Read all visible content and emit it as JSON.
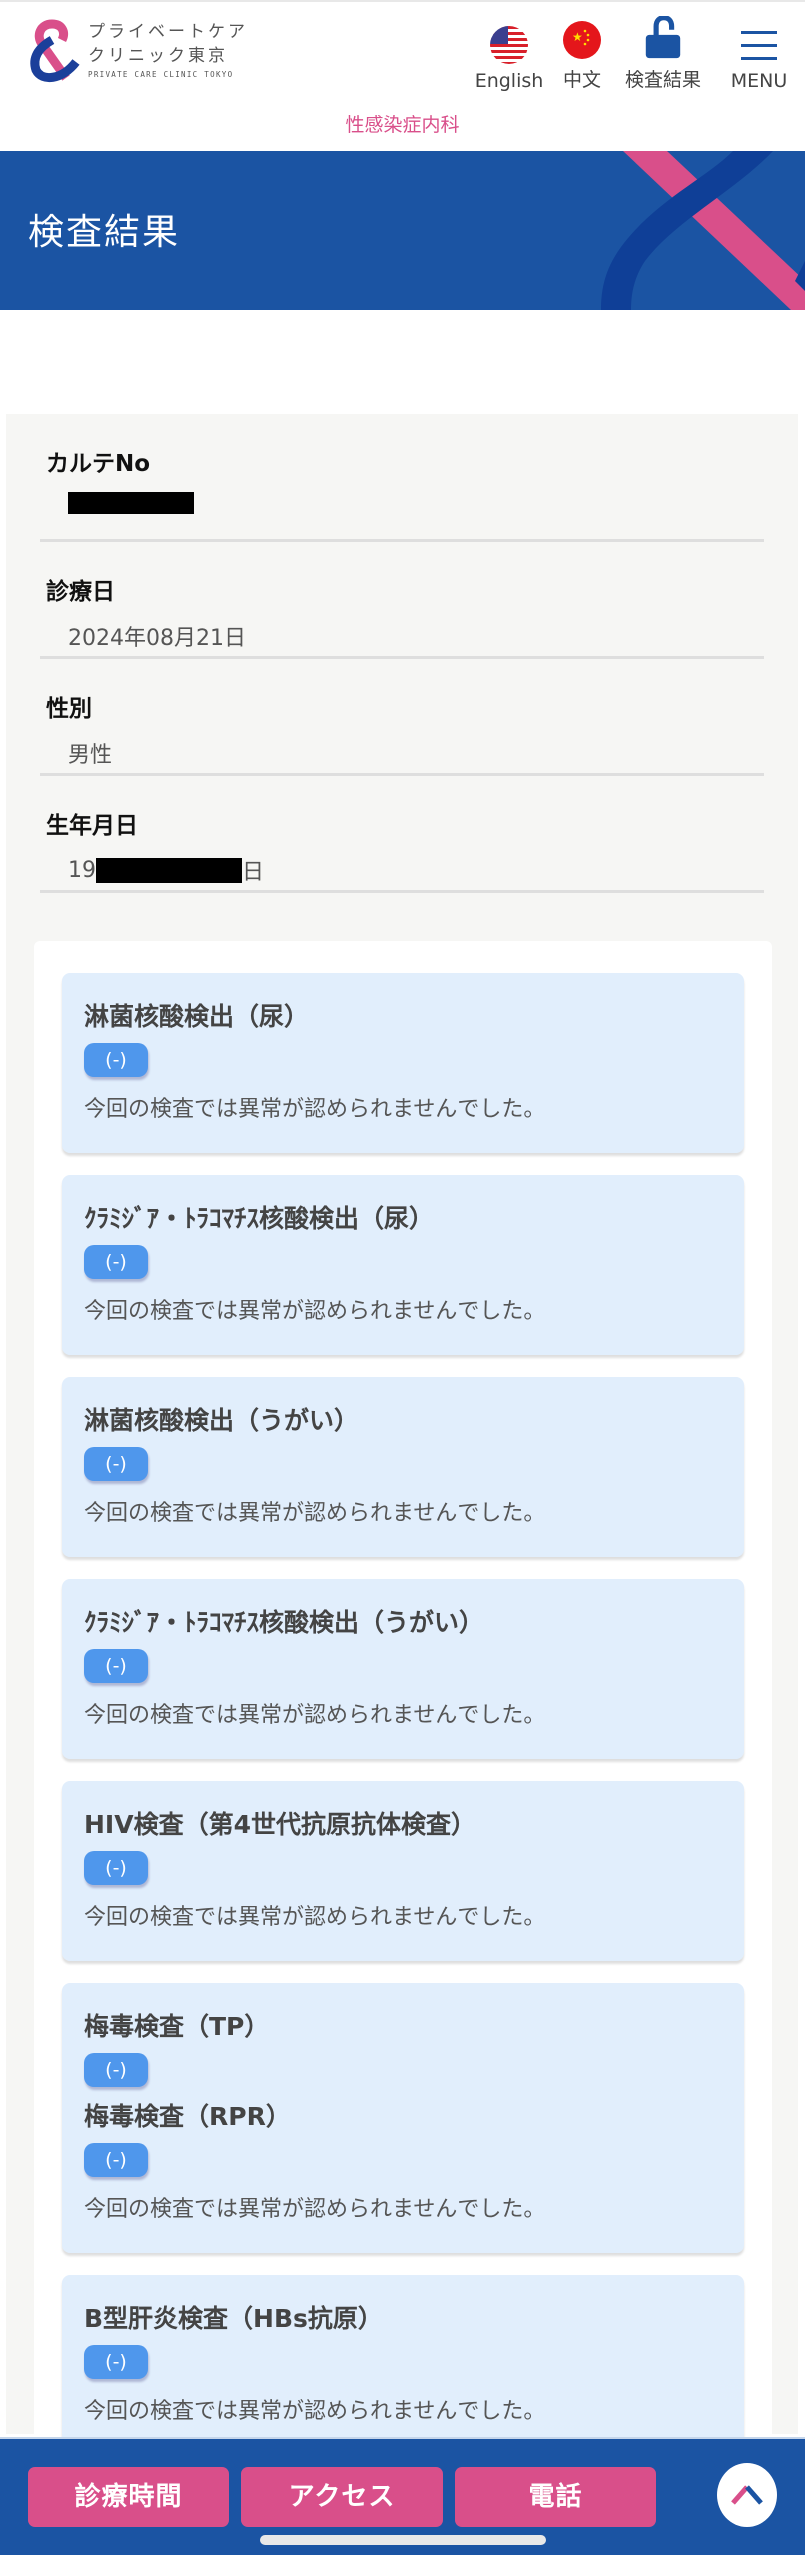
{
  "header": {
    "logo_jp_line1": "プライベートケア",
    "logo_jp_line2": "クリニック東京",
    "logo_en": "PRIVATE CARE CLINIC TOKYO",
    "subtitle": "性感染症内科",
    "nav": [
      {
        "label": "English",
        "icon": "us-flag-icon"
      },
      {
        "label": "中文",
        "icon": "china-flag-icon"
      },
      {
        "label": "検査結果",
        "icon": "unlock-icon"
      },
      {
        "label": "MENU",
        "icon": "hamburger-menu-icon"
      }
    ]
  },
  "hero": {
    "title": "検査結果"
  },
  "patient_info": [
    {
      "label": "カルテNo",
      "value": "",
      "redacted": true
    },
    {
      "label": "診療日",
      "value": "2024年08月21日"
    },
    {
      "label": "性別",
      "value": "男性"
    },
    {
      "label": "生年月日",
      "value_prefix": "19",
      "value_suffix": "日",
      "redacted": true
    }
  ],
  "results": [
    {
      "tests": [
        {
          "name": "淋菌核酸検出（尿）",
          "result": "(-)"
        }
      ],
      "note": "今回の検査では異常が認められませんでした。"
    },
    {
      "tests": [
        {
          "name": "ｸﾗﾐｼﾞｱ・ﾄﾗｺﾏﾁｽ核酸検出（尿）",
          "result": "(-)"
        }
      ],
      "note": "今回の検査では異常が認められませんでした。"
    },
    {
      "tests": [
        {
          "name": "淋菌核酸検出（うがい）",
          "result": "(-)"
        }
      ],
      "note": "今回の検査では異常が認められませんでした。"
    },
    {
      "tests": [
        {
          "name": "ｸﾗﾐｼﾞｱ・ﾄﾗｺﾏﾁｽ核酸検出（うがい）",
          "result": "(-)"
        }
      ],
      "note": "今回の検査では異常が認められませんでした。"
    },
    {
      "tests": [
        {
          "name": "HIV検査（第4世代抗原抗体検査）",
          "result": "(-)"
        }
      ],
      "note": "今回の検査では異常が認められませんでした。"
    },
    {
      "tests": [
        {
          "name": "梅毒検査（TP）",
          "result": "(-)"
        },
        {
          "name": "梅毒検査（RPR）",
          "result": "(-)"
        }
      ],
      "note": "今回の検査では異常が認められませんでした。"
    },
    {
      "tests": [
        {
          "name": "B型肝炎検査（HBs抗原）",
          "result": "(-)"
        }
      ],
      "note": "今回の検査では異常が認められませんでした。"
    }
  ],
  "footer": {
    "buttons": [
      "診療時間",
      "アクセス",
      "電話"
    ],
    "to_top_icon": "chevron-up-icon"
  },
  "colors": {
    "brand_blue": "#1b54a3",
    "brand_pink": "#d94f8a",
    "badge_blue": "#4f97ec",
    "card_bg": "#e1eefc"
  }
}
